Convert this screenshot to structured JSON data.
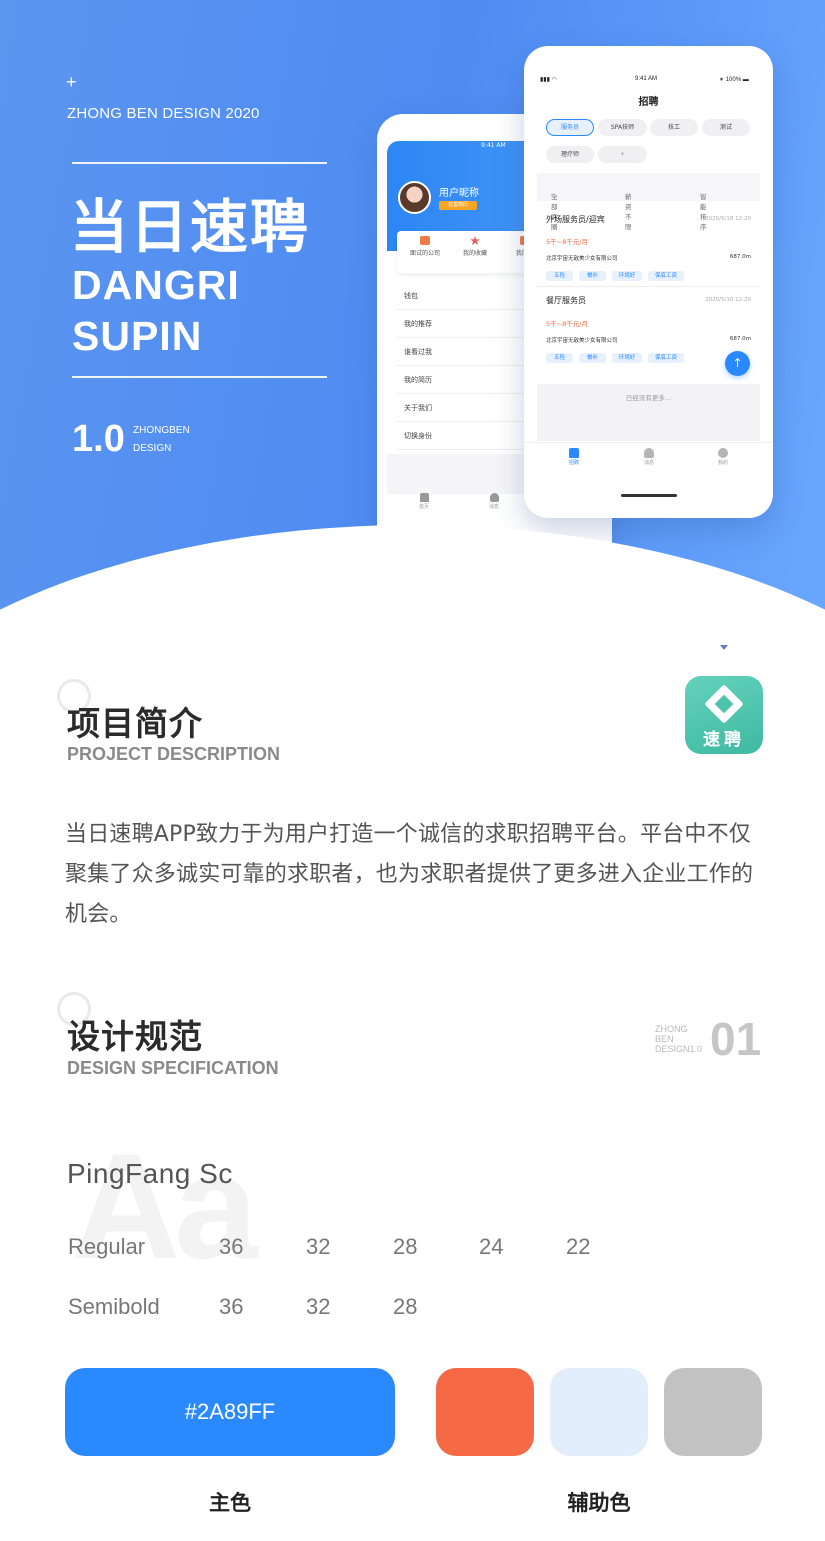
{
  "hero": {
    "plus": "+",
    "studio": "ZHONG BEN DESIGN 2020",
    "title_cn": "当日速聘",
    "title_en_1": "DANGRI",
    "title_en_2": "SUPIN",
    "version": "1.0",
    "version_sub_1": "ZHONGBEN",
    "version_sub_2": "DESIGN"
  },
  "profile_screen": {
    "status_time": "9:41 AM",
    "user_name": "用户昵称",
    "user_tag": "完善简历",
    "quick_items": [
      "面试的公司",
      "我的收藏",
      "我的记"
    ],
    "menu": [
      "钱包",
      "我的推荐",
      "谁看过我",
      "我的简历",
      "关于我们",
      "切换身份"
    ],
    "tabs": [
      "首页",
      "消息"
    ]
  },
  "job_screen": {
    "status_time": "9:41 AM",
    "battery": "100%",
    "title": "招聘",
    "chips": [
      "服务员",
      "SPA技师",
      "技工",
      "测试",
      "理疗师",
      "+"
    ],
    "filters": [
      "全部商圈",
      "薪资不限",
      "智能排序"
    ],
    "jobs": [
      {
        "title": "外场服务员/迎宾",
        "date": "2020/5/18 12:20",
        "salary": "5千~8千元/月",
        "company": "北京宇宙无敌美少女有限公司",
        "distance": "687.0m",
        "tags": [
          "五险",
          "餐补",
          "环境好",
          "保底工资"
        ]
      },
      {
        "title": "餐厅服务员",
        "date": "2020/5/10 12:20",
        "salary": "5千~8千元/月",
        "company": "北京宇宙无敌美少女有限公司",
        "distance": "687.0m",
        "tags": [
          "五险",
          "餐补",
          "环境好",
          "保底工资"
        ]
      }
    ],
    "fab": "↑",
    "no_more": "已经没有更多...",
    "tabs": [
      "招聘",
      "消息",
      "我的"
    ]
  },
  "project": {
    "title_cn": "项目简介",
    "title_en": "PROJECT DESCRIPTION",
    "logo_text": "速聘",
    "description": "当日速聘APP致力于为用户打造一个诚信的求职招聘平台。平台中不仅聚集了众多诚实可靠的求职者，也为求职者提供了更多进入企业工作的机会。"
  },
  "spec": {
    "title_cn": "设计规范",
    "title_en": "DESIGN SPECIFICATION",
    "badge_small_1": "ZHONG",
    "badge_small_2": "BEN",
    "badge_small_3": "DESIGN1.0",
    "badge_number": "01",
    "aa": "Aa",
    "font_name": "PingFang  Sc",
    "regular_label": "Regular",
    "regular_sizes": [
      "36",
      "32",
      "28",
      "24",
      "22"
    ],
    "semibold_label": "Semibold",
    "semibold_sizes": [
      "36",
      "32",
      "28"
    ]
  },
  "colors": {
    "primary_hex": "#2A89FF",
    "primary": "#2a89ff",
    "secondary": [
      "#f56a45",
      "#e3eefc",
      "#c2c2c2"
    ],
    "primary_label": "主色",
    "secondary_label": "辅助色"
  }
}
